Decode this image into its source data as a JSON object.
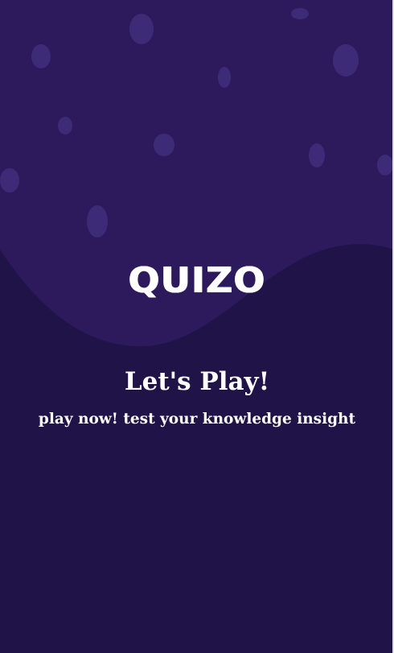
{
  "app": {
    "logo_text": "QUIZO"
  },
  "splash": {
    "headline": "Let's Play!",
    "subline": "play now! test your knowledge insight"
  },
  "colors": {
    "background_dark": "#1f1348",
    "background_light": "#2c1a5c",
    "bubble": "#3d2b77",
    "text": "#ffffff"
  }
}
